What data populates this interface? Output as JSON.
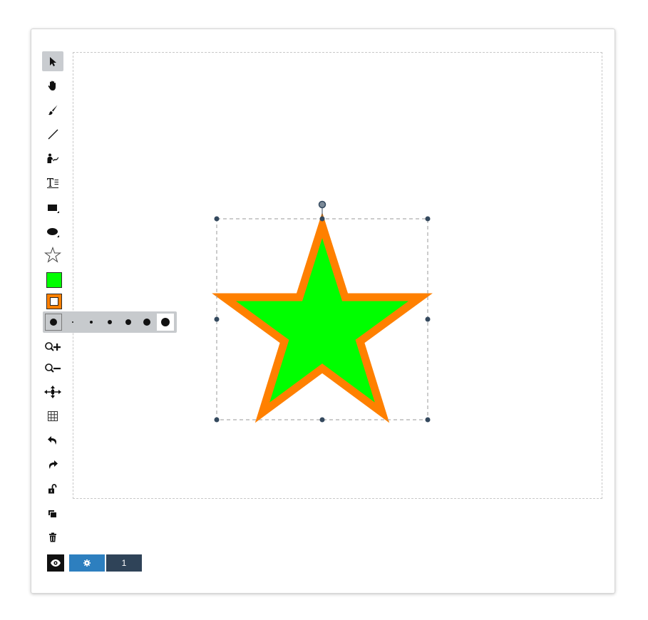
{
  "toolbar": {
    "tools": [
      {
        "name": "select-tool",
        "icon": "arrow-pointer-icon",
        "active": true
      },
      {
        "name": "pan-tool",
        "icon": "hand-icon"
      },
      {
        "name": "brush-tool",
        "icon": "paintbrush-icon"
      },
      {
        "name": "line-tool",
        "icon": "line-icon"
      },
      {
        "name": "signature-tool",
        "icon": "signature-icon"
      },
      {
        "name": "text-tool",
        "icon": "text-icon"
      },
      {
        "name": "rectangle-tool",
        "icon": "rectangle-icon"
      },
      {
        "name": "ellipse-tool",
        "icon": "ellipse-icon"
      },
      {
        "name": "star-tool",
        "icon": "star-icon"
      }
    ],
    "fill_color": "#00ff00",
    "stroke_color": "#ff8000",
    "stroke_widths": {
      "current_index": 0,
      "selected_index": 6,
      "options": [
        "width-1",
        "width-2",
        "width-3",
        "width-4",
        "width-5",
        "width-6"
      ]
    },
    "actions": [
      {
        "name": "zoom-in-button",
        "icon": "zoom-in-icon"
      },
      {
        "name": "zoom-out-button",
        "icon": "zoom-out-icon"
      },
      {
        "name": "move-button",
        "icon": "arrows-move-icon"
      },
      {
        "name": "grid-button",
        "icon": "grid-icon"
      },
      {
        "name": "undo-button",
        "icon": "undo-icon"
      },
      {
        "name": "redo-button",
        "icon": "redo-icon"
      },
      {
        "name": "lock-button",
        "icon": "unlock-icon"
      },
      {
        "name": "clone-button",
        "icon": "clone-icon"
      },
      {
        "name": "delete-button",
        "icon": "trash-icon"
      }
    ]
  },
  "canvas": {
    "shape": {
      "type": "star",
      "fill": "#00ff00",
      "stroke": "#ff8000",
      "selected": true
    },
    "selection_color": "#34495e"
  },
  "footer": {
    "preview_icon": "eye-icon",
    "settings_icon": "gear-icon",
    "page_number": "1"
  }
}
